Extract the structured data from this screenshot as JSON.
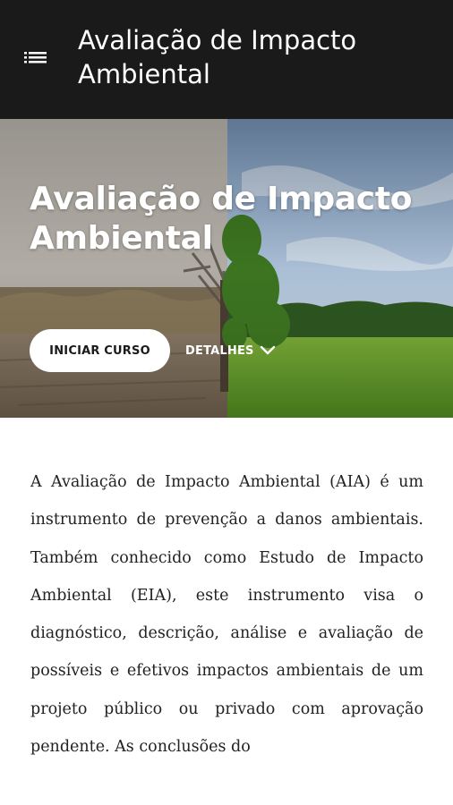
{
  "app_bar": {
    "title": "Avaliação de Impacto Ambiental",
    "menu_icon": "list-menu-icon"
  },
  "hero": {
    "title": "Avaliação de Impacto Ambiental",
    "start_button": "INICIAR CURSO",
    "details_button": "DETALHES",
    "details_icon": "chevron-down-icon"
  },
  "content": {
    "paragraph": "A Avaliação de Impacto Ambiental (AIA) é um instrumento de prevenção a danos ambientais. Também conhecido como Estudo de Impacto Ambiental (EIA), este instrumento visa o diagnóstico, descrição, análise e avaliação de possíveis e efetivos impactos ambientais de um projeto público ou privado com aprovação pendente. As conclusões do"
  },
  "colors": {
    "app_bar_bg": "#1a1a1a",
    "text": "#222222",
    "button_bg": "#ffffff"
  }
}
